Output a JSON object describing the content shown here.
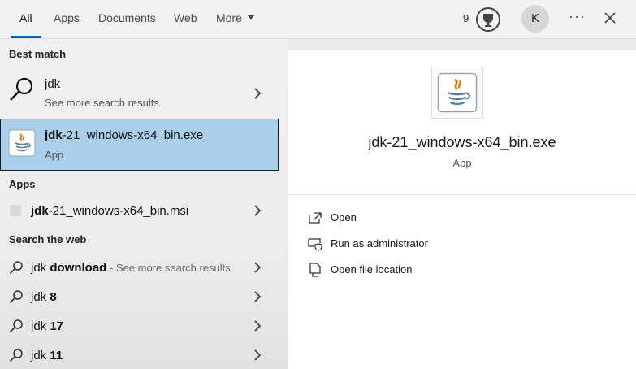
{
  "tabs": [
    {
      "label": "All",
      "active": true
    },
    {
      "label": "Apps"
    },
    {
      "label": "Documents"
    },
    {
      "label": "Web"
    },
    {
      "label": "More"
    }
  ],
  "header": {
    "points": "9",
    "avatar_initial": "K",
    "more_options": "···"
  },
  "sections": {
    "best_match": "Best match",
    "apps": "Apps",
    "search_web": "Search the web"
  },
  "best_match": {
    "query": "jdk",
    "query_sub": "See more search results",
    "selected_name_bold": "jdk",
    "selected_name_rest": "-21_windows-x64_bin.exe",
    "selected_type": "App"
  },
  "apps_results": [
    {
      "bold": "jdk",
      "rest": "-21_windows-x64_bin.msi"
    }
  ],
  "web_results": [
    {
      "main": "jdk ",
      "bold": "download",
      "sub": " - See more search results"
    },
    {
      "main": "jdk ",
      "bold": "8",
      "sub": ""
    },
    {
      "main": "jdk ",
      "bold": "17",
      "sub": ""
    },
    {
      "main": "jdk ",
      "bold": "11",
      "sub": ""
    }
  ],
  "detail": {
    "title": "jdk-21_windows-x64_bin.exe",
    "type": "App",
    "actions": [
      "Open",
      "Run as administrator",
      "Open file location"
    ]
  },
  "colors": {
    "selected_row_bg": "#a9cfea",
    "accent": "#0063b1"
  }
}
